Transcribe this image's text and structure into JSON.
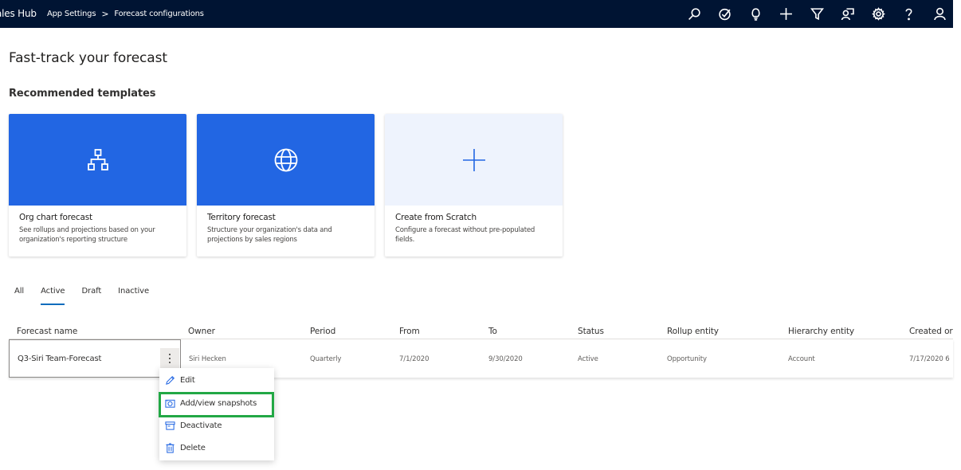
{
  "topbar": {
    "app_name": "ales Hub",
    "breadcrumb": [
      "App Settings",
      "Forecast configurations"
    ],
    "breadcrumb_separator": ">",
    "icons": [
      "search-icon",
      "task-icon",
      "lightbulb-icon",
      "plus-icon",
      "filter-icon",
      "assistant-icon",
      "gear-icon",
      "help-icon",
      "user-icon"
    ],
    "background_color": "#001433"
  },
  "page": {
    "title": "Fast-track your forecast",
    "section_title": "Recommended templates"
  },
  "templates": [
    {
      "title": "Org chart forecast",
      "description": "See rollups and projections based on your organization's reporting structure",
      "icon": "org-chart-icon",
      "color": "#2266e3"
    },
    {
      "title": "Territory forecast",
      "description": "Structure your organization's data and projections by sales regions",
      "icon": "globe-icon",
      "color": "#2266e3"
    },
    {
      "title": "Create from Scratch",
      "description": "Configure a forecast without pre-populated fields.",
      "icon": "plus-icon",
      "color": "#eef3fd"
    }
  ],
  "tabs": [
    {
      "label": "All",
      "active": false
    },
    {
      "label": "Active",
      "active": true
    },
    {
      "label": "Draft",
      "active": false
    },
    {
      "label": "Inactive",
      "active": false
    }
  ],
  "grid": {
    "columns": [
      "Forecast name",
      "Owner",
      "Period",
      "From",
      "To",
      "Status",
      "Rollup entity",
      "Hierarchy entity",
      "Created or"
    ],
    "rows": [
      {
        "name": "Q3-Siri Team-Forecast",
        "owner": "Siri Hecken",
        "period": "Quarterly",
        "from": "7/1/2020",
        "to": "9/30/2020",
        "status": "Active",
        "rollup_entity": "Opportunity",
        "hierarchy_entity": "Account",
        "created_on": "7/17/2020 6"
      }
    ]
  },
  "context_menu": {
    "items": [
      {
        "label": "Edit",
        "icon": "pencil-icon"
      },
      {
        "label": "Add/view snapshots",
        "icon": "camera-icon",
        "highlighted": true
      },
      {
        "label": "Deactivate",
        "icon": "archive-icon"
      },
      {
        "label": "Delete",
        "icon": "trash-icon"
      }
    ],
    "highlight_color": "#22a845"
  }
}
